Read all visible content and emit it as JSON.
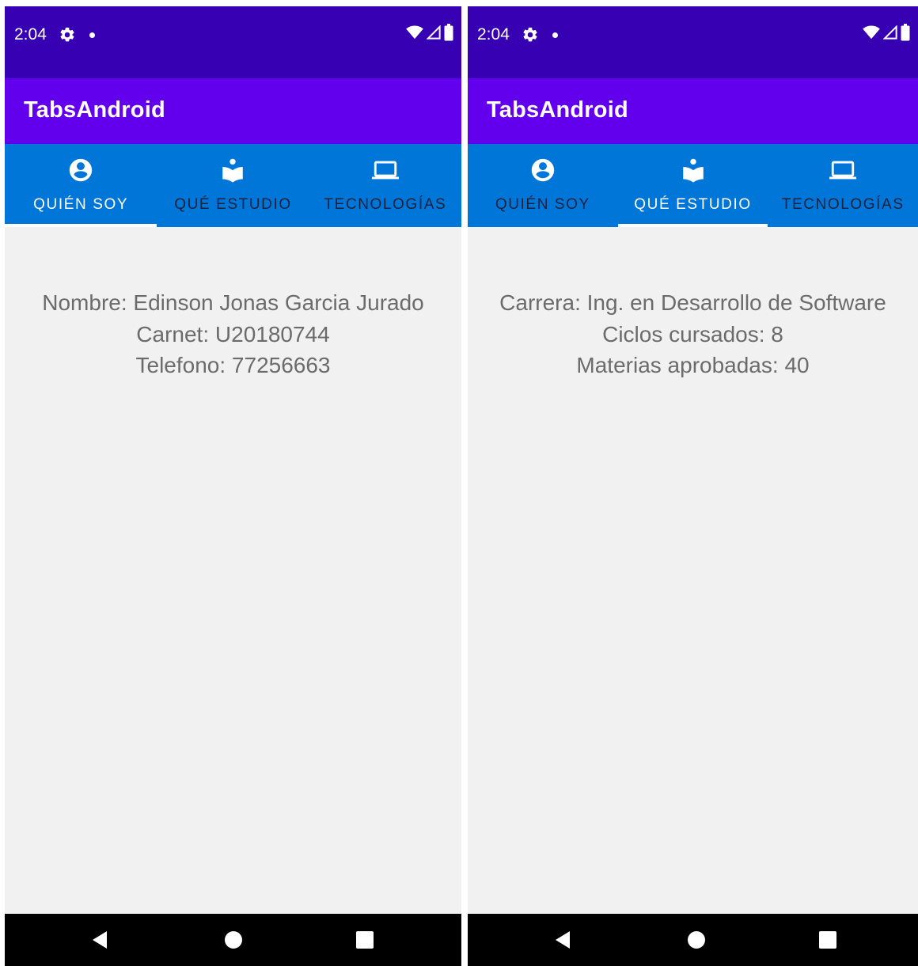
{
  "screens": [
    {
      "status": {
        "time": "2:04"
      },
      "app_title": "TabsAndroid",
      "tabs": [
        {
          "label": "QUIÉN SOY",
          "icon": "account-circle-icon"
        },
        {
          "label": "QUÉ ESTUDIO",
          "icon": "book-reader-icon"
        },
        {
          "label": "TECNOLOGÍAS",
          "icon": "laptop-icon"
        }
      ],
      "active_tab": 0,
      "content": {
        "lines": [
          "Nombre: Edinson Jonas Garcia Jurado",
          "Carnet: U20180744",
          "Telefono: 77256663"
        ]
      }
    },
    {
      "status": {
        "time": "2:04"
      },
      "app_title": "TabsAndroid",
      "tabs": [
        {
          "label": "QUIÉN SOY",
          "icon": "account-circle-icon"
        },
        {
          "label": "QUÉ ESTUDIO",
          "icon": "book-reader-icon"
        },
        {
          "label": "TECNOLOGÍAS",
          "icon": "laptop-icon"
        }
      ],
      "active_tab": 1,
      "content": {
        "lines": [
          "Carrera: Ing. en Desarrollo de Software",
          "Ciclos cursados: 8",
          "Materias aprobadas: 40"
        ]
      }
    }
  ],
  "colors": {
    "status_bar": "#3700b3",
    "app_bar": "#6200ee",
    "tab_bar": "#0077d8",
    "tab_active_text": "#ffffff",
    "tab_inactive_text": "#16213d",
    "content_background": "#f1f1f1",
    "content_text": "#6b6b6b"
  }
}
